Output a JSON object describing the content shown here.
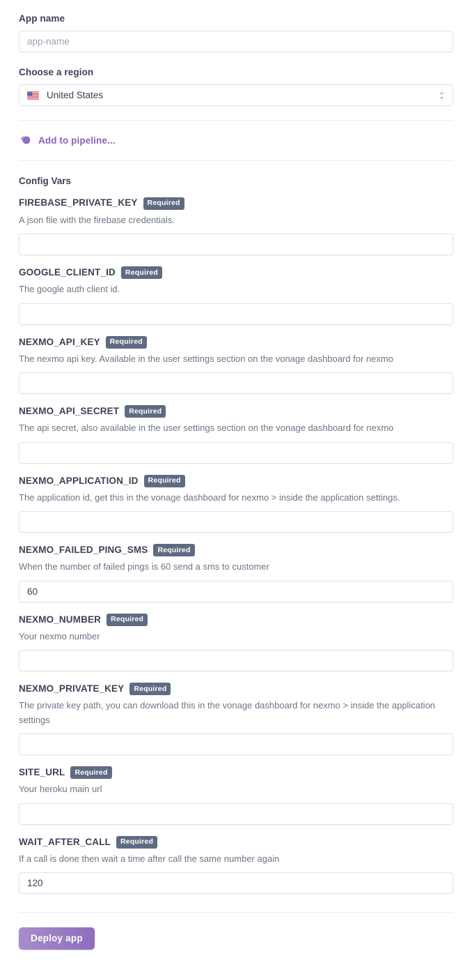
{
  "form": {
    "app_name": {
      "label": "App name",
      "placeholder": "app-name",
      "value": ""
    },
    "region": {
      "label": "Choose a region",
      "selected": "United States",
      "flag_icon": "united-states-flag-icon"
    },
    "pipeline": {
      "label": "Add to pipeline...",
      "icon": "pipeline-stack-icon",
      "accent_color": "#8a62b8"
    },
    "config_vars_heading": "Config Vars",
    "required_badge": "Required",
    "badge_color": "#5e6b82",
    "deploy_button": {
      "label": "Deploy app",
      "color_start": "#a98ecb",
      "color_end": "#8e6dbe"
    }
  },
  "config_vars": [
    {
      "name": "FIREBASE_PRIVATE_KEY",
      "required": "Required",
      "description": "A json file with the firebase credentials.",
      "value": "",
      "placeholder": ""
    },
    {
      "name": "GOOGLE_CLIENT_ID",
      "required": "Required",
      "description": "The google auth client id.",
      "value": "",
      "placeholder": ""
    },
    {
      "name": "NEXMO_API_KEY",
      "required": "Required",
      "description": "The nexmo api key. Available in the user settings section on the vonage dashboard for nexmo",
      "value": "",
      "placeholder": ""
    },
    {
      "name": "NEXMO_API_SECRET",
      "required": "Required",
      "description": "The api secret, also available in the user settings section on the vonage dashboard for nexmo",
      "value": "",
      "placeholder": ""
    },
    {
      "name": "NEXMO_APPLICATION_ID",
      "required": "Required",
      "description": "The application id, get this in the vonage dashboard for nexmo > inside the application settings.",
      "value": "",
      "placeholder": ""
    },
    {
      "name": "NEXMO_FAILED_PING_SMS",
      "required": "Required",
      "description": "When the number of failed pings is 60 send a sms to customer",
      "value": "60",
      "placeholder": ""
    },
    {
      "name": "NEXMO_NUMBER",
      "required": "Required",
      "description": "Your nexmo number",
      "value": "",
      "placeholder": ""
    },
    {
      "name": "NEXMO_PRIVATE_KEY",
      "required": "Required",
      "description": "The private key path, you can download this in the vonage dashboard for nexmo > inside the application settings",
      "value": "",
      "placeholder": ""
    },
    {
      "name": "SITE_URL",
      "required": "Required",
      "description": "Your heroku main url",
      "value": "",
      "placeholder": ""
    },
    {
      "name": "WAIT_AFTER_CALL",
      "required": "Required",
      "description": "If a call is done then wait a time after call the same number again",
      "value": "120",
      "placeholder": ""
    }
  ]
}
